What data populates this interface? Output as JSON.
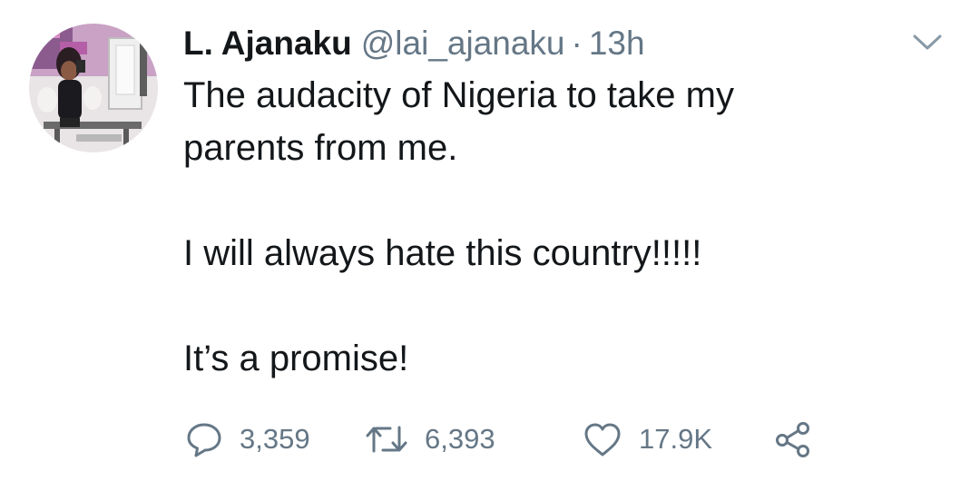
{
  "tweet": {
    "author": {
      "name": "L. Ajanaku",
      "handle": "@lai_ajanaku",
      "separator": "·",
      "time": "13h",
      "avatar_icon": "profile-photo"
    },
    "body": {
      "line1": "The audacity of Nigeria to take my",
      "line2": "parents from me.",
      "line3": "I will always hate this country!!!!!",
      "line4": "It’s a promise!"
    },
    "actions": {
      "reply": {
        "icon": "speech-bubble-icon",
        "count": "3,359"
      },
      "retweet": {
        "icon": "retweet-icon",
        "count": "6,393"
      },
      "like": {
        "icon": "heart-icon",
        "count": "17.9K"
      },
      "share": {
        "icon": "share-icon"
      }
    },
    "menu_icon": "chevron-down-icon",
    "colors": {
      "text": "#14171a",
      "secondary": "#657786",
      "background": "#ffffff"
    }
  }
}
